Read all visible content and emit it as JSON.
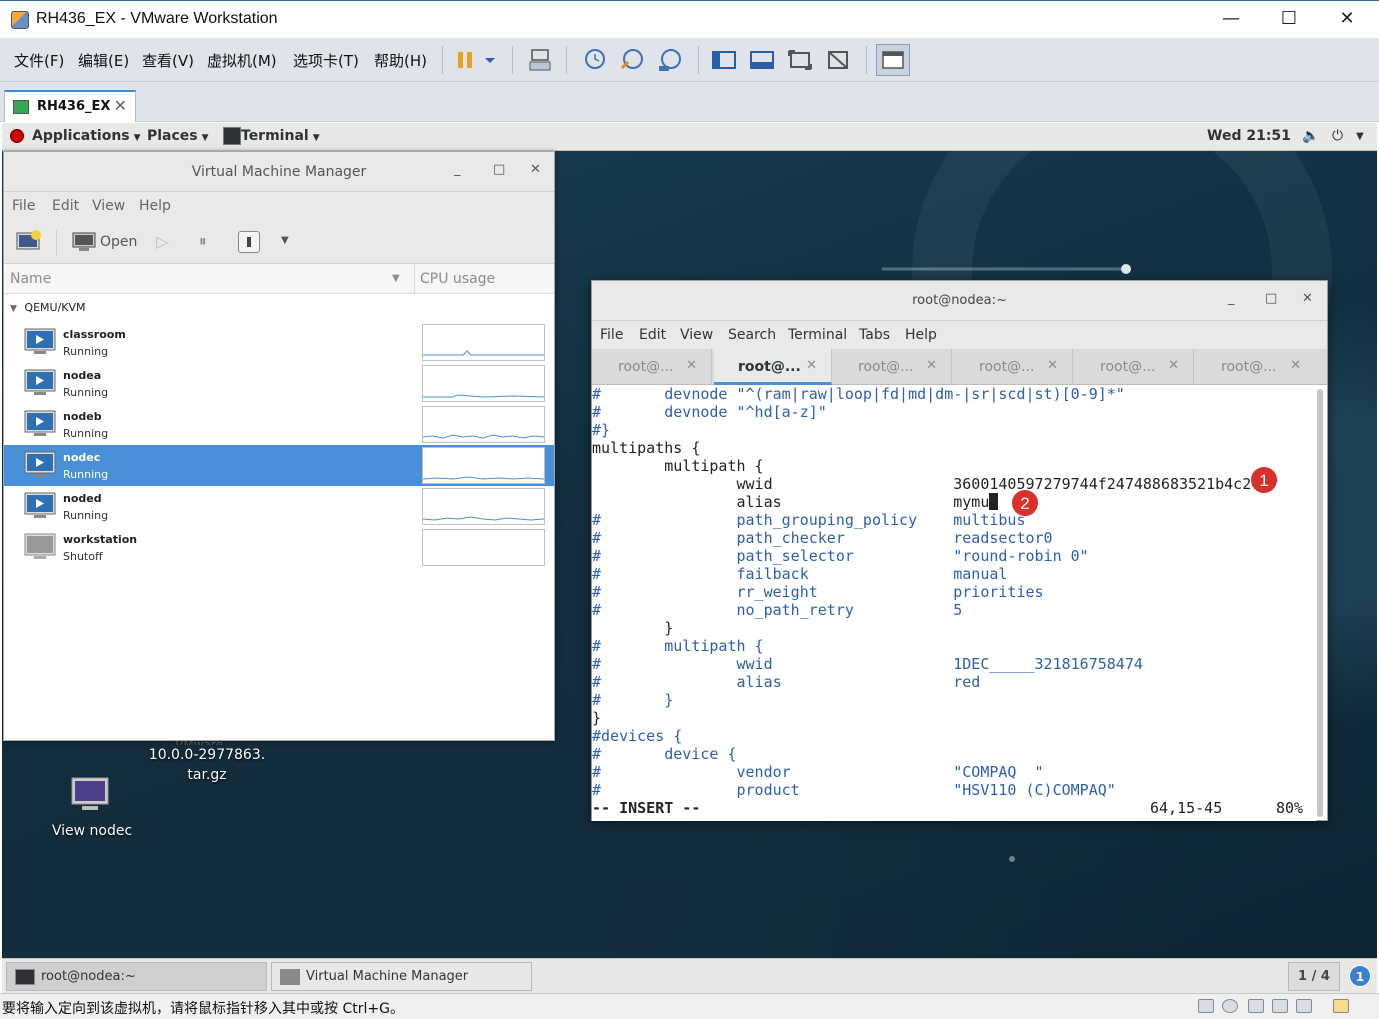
{
  "host": {
    "title": "RH436_EX - VMware Workstation",
    "controls": {
      "minimize": "—",
      "maximize": "☐",
      "close": "✕"
    },
    "menu": [
      "文件(F)",
      "编辑(E)",
      "查看(V)",
      "虚拟机(M)",
      "选项卡(T)",
      "帮助(H)"
    ],
    "tab_label": "RH436_EX",
    "tab_close": "✕",
    "status_message": "要将输入定向到该虚拟机，请将鼠标指针移入其中或按 Ctrl+G。"
  },
  "guest_panel": {
    "applications": "Applications",
    "places": "Places",
    "terminal": "Terminal",
    "clock": "Wed 21:51"
  },
  "vmm": {
    "title": "Virtual Machine Manager",
    "menu": [
      "File",
      "Edit",
      "View",
      "Help"
    ],
    "open_label": "Open",
    "col_name": "Name",
    "col_cpu": "CPU usage",
    "group": "QEMU/KVM",
    "vms": [
      {
        "name": "classroom",
        "state": "Running"
      },
      {
        "name": "nodea",
        "state": "Running"
      },
      {
        "name": "nodeb",
        "state": "Running"
      },
      {
        "name": "nodec",
        "state": "Running"
      },
      {
        "name": "noded",
        "state": "Running"
      },
      {
        "name": "workstation",
        "state": "Shutoff"
      }
    ],
    "selected_index": 3
  },
  "desktop": {
    "file_label_1": "10.0.0-2977863.",
    "file_label_2": "tar.gz",
    "icon_label": "View nodec"
  },
  "terminal": {
    "title": "root@nodea:~",
    "menu": [
      "File",
      "Edit",
      "View",
      "Search",
      "Terminal",
      "Tabs",
      "Help"
    ],
    "tabs": [
      "root@...",
      "root@...",
      "root@...",
      "root@...",
      "root@...",
      "root@..."
    ],
    "active_tab": 1,
    "tab_close": "✕",
    "lines": [
      "#       devnode \"^(ram|raw|loop|fd|md|dm-|sr|scd|st)[0-9]*\"",
      "#       devnode \"^hd[a-z]\"",
      "#}",
      "multipaths {",
      "        multipath {",
      "                wwid                    36001405972797­44f247488683521b4c2",
      "                alias                   mymu",
      "#               path_grouping_policy    multibus",
      "#               path_checker            readsector0",
      "#               path_selector           \"round-robin 0\"",
      "#               failback                manual",
      "#               rr_weight               priorities",
      "#               no_path_retry           5",
      "        }",
      "#       multipath {",
      "#               wwid                    1DEC_____321816758474",
      "#               alias                   red",
      "#       }",
      "}",
      "#devices {",
      "#       device {",
      "#               vendor                  \"COMPAQ  \"",
      "#               product                 \"HSV110 (C)COMPAQ\""
    ],
    "status_mode": "-- INSERT --",
    "status_pos": "64,15-45",
    "status_pct": "80%",
    "markers": [
      "1",
      "2"
    ]
  },
  "bottom_panel": {
    "task1": "root@nodea:~",
    "task2": "Virtual Machine Manager",
    "workspace": "1 / 4",
    "badge": "1"
  },
  "colors": {
    "selection": "#4a90d9",
    "comment_blue": "#2d5fb0",
    "marker_red": "#d9302c"
  }
}
